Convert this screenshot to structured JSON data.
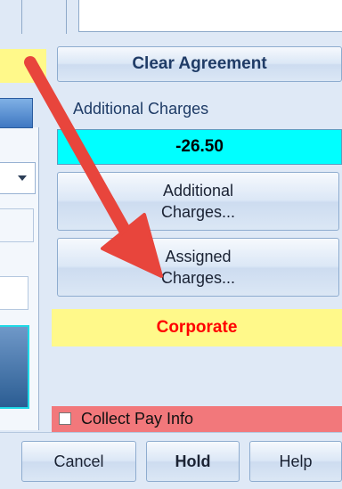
{
  "buttons": {
    "clear_agreement": "Clear Agreement",
    "additional_charges_line1": "Additional",
    "additional_charges_line2": "Charges...",
    "assigned_charges_line1": "Assigned",
    "assigned_charges_line2": "Charges...",
    "cancel": "Cancel",
    "hold": "Hold",
    "help": "Help"
  },
  "labels": {
    "additional_charges": "Additional Charges",
    "amount": "-26.50",
    "corporate": "Corporate",
    "collect_pay_info": "Collect Pay Info"
  },
  "checkbox": {
    "collect_pay_info_checked": false
  },
  "colors": {
    "amount_bg": "#00ffff",
    "corporate_bg": "#fff98a",
    "corporate_text": "#ff0000",
    "collect_row_bg": "#f2787b",
    "annotation_arrow": "#e8453c"
  },
  "icons": {
    "left_dropdown": "chevron-down-icon",
    "overlay": "red-annotation-arrow"
  }
}
